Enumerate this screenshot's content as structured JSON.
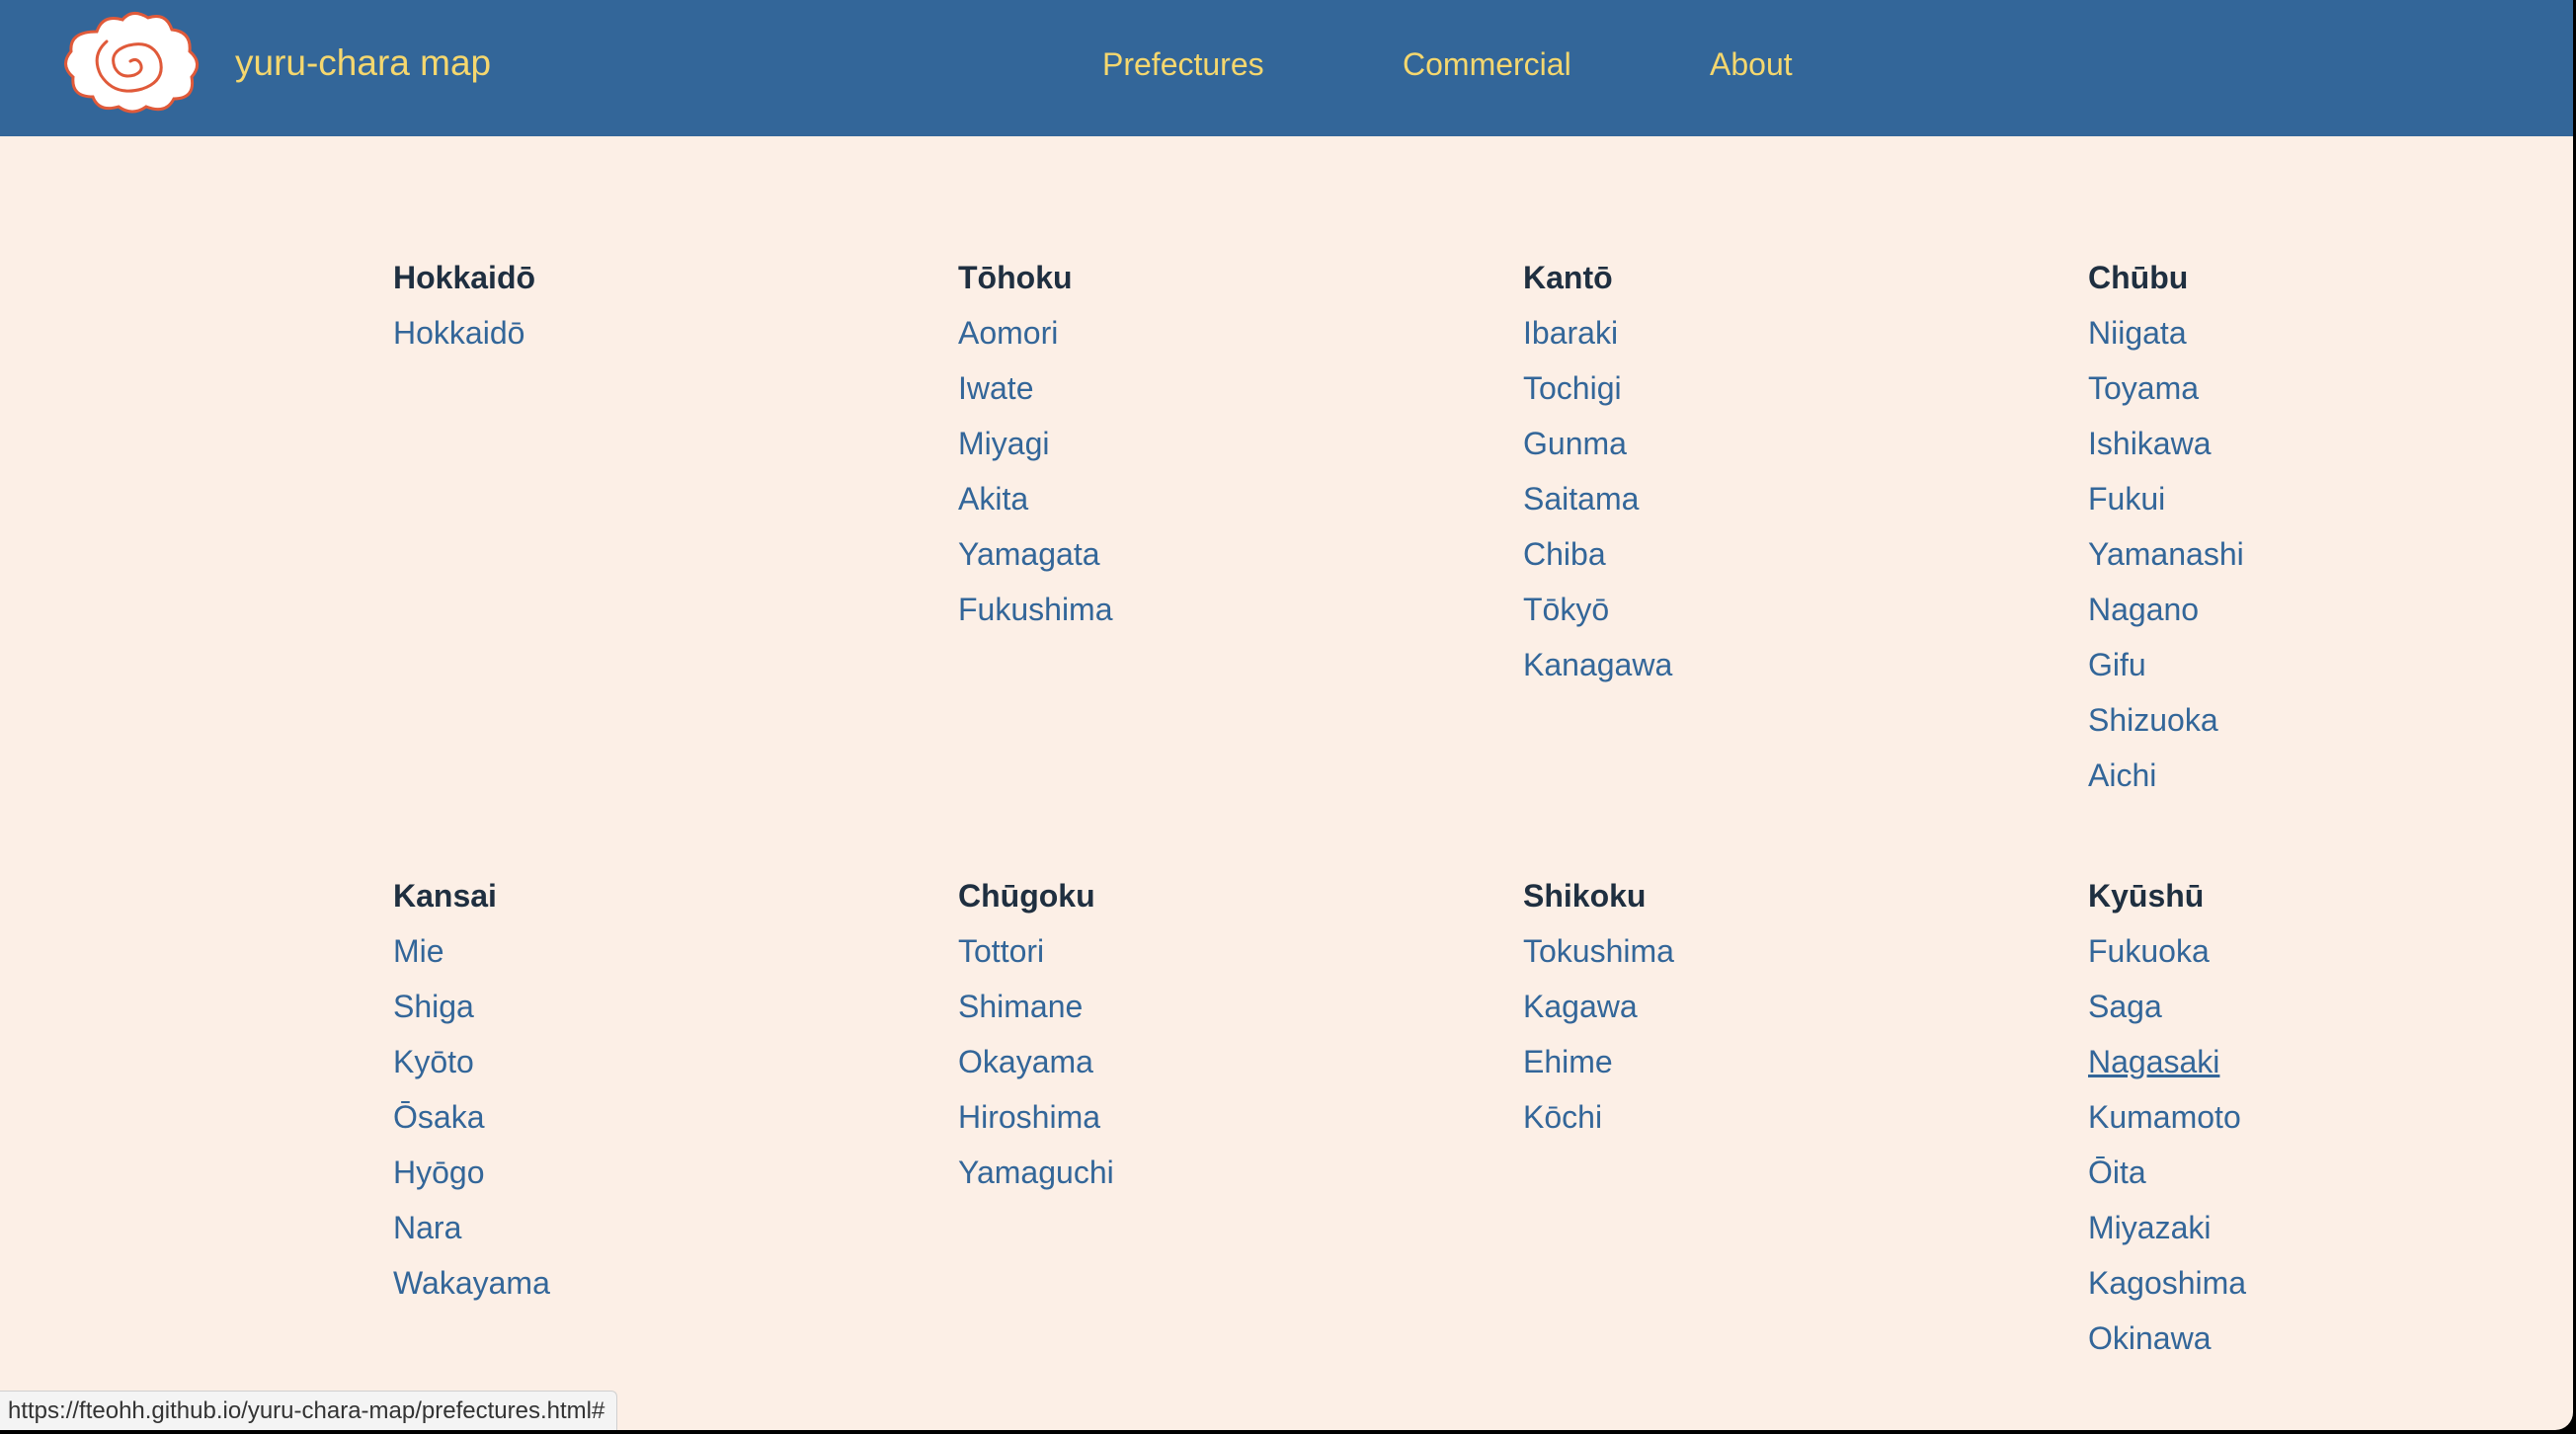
{
  "header": {
    "brand": "yuru-chara map",
    "nav": [
      {
        "label": "Prefectures"
      },
      {
        "label": "Commercial"
      },
      {
        "label": "About"
      }
    ],
    "colors": {
      "background": "#336699",
      "text": "#f5d76e"
    },
    "logo_icon": "naruto-swirl-logo"
  },
  "regions": [
    {
      "name": "Hokkaidō",
      "prefectures": [
        "Hokkaidō"
      ]
    },
    {
      "name": "Tōhoku",
      "prefectures": [
        "Aomori",
        "Iwate",
        "Miyagi",
        "Akita",
        "Yamagata",
        "Fukushima"
      ]
    },
    {
      "name": "Kantō",
      "prefectures": [
        "Ibaraki",
        "Tochigi",
        "Gunma",
        "Saitama",
        "Chiba",
        "Tōkyō",
        "Kanagawa"
      ]
    },
    {
      "name": "Chūbu",
      "prefectures": [
        "Niigata",
        "Toyama",
        "Ishikawa",
        "Fukui",
        "Yamanashi",
        "Nagano",
        "Gifu",
        "Shizuoka",
        "Aichi"
      ]
    },
    {
      "name": "Kansai",
      "prefectures": [
        "Mie",
        "Shiga",
        "Kyōto",
        "Ōsaka",
        "Hyōgo",
        "Nara",
        "Wakayama"
      ]
    },
    {
      "name": "Chūgoku",
      "prefectures": [
        "Tottori",
        "Shimane",
        "Okayama",
        "Hiroshima",
        "Yamaguchi"
      ]
    },
    {
      "name": "Shikoku",
      "prefectures": [
        "Tokushima",
        "Kagawa",
        "Ehime",
        "Kōchi"
      ]
    },
    {
      "name": "Kyūshū",
      "prefectures": [
        "Fukuoka",
        "Saga",
        "Nagasaki",
        "Kumamoto",
        "Ōita",
        "Miyazaki",
        "Kagoshima",
        "Okinawa"
      ]
    }
  ],
  "hovered_prefecture": "Nagasaki",
  "status_bar": {
    "url": "https://fteohh.github.io/yuru-chara-map/prefectures.html#"
  },
  "colors": {
    "page_background": "#fcefe6",
    "link": "#336699",
    "heading": "#1f2f40"
  }
}
